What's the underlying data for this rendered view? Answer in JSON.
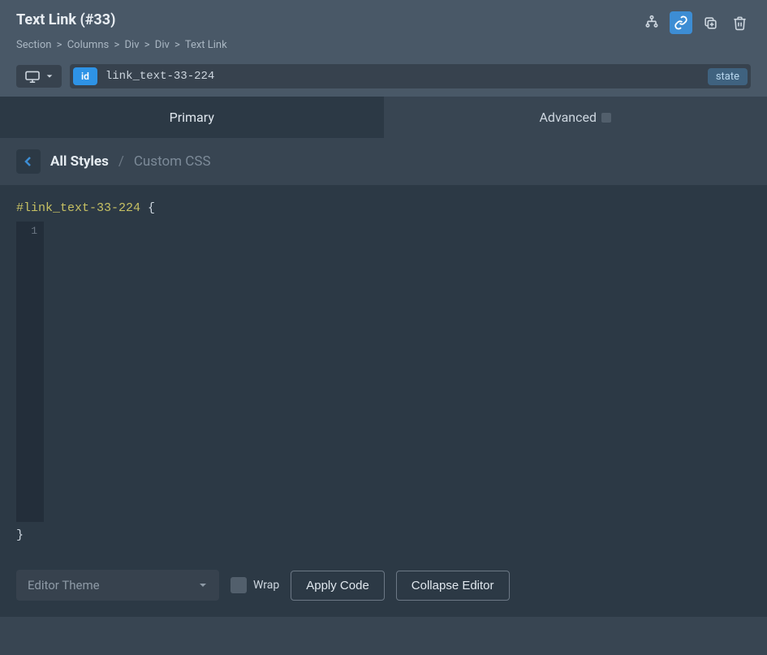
{
  "header": {
    "title": "Text Link (#33)",
    "breadcrumb": [
      "Section",
      "Columns",
      "Div",
      "Div",
      "Text Link"
    ]
  },
  "toolbar": {
    "id_badge": "id",
    "id_value": "link_text-33-224",
    "state_label": "state"
  },
  "tabs": {
    "primary": "Primary",
    "advanced": "Advanced"
  },
  "subheader": {
    "all_styles": "All Styles",
    "current": "Custom CSS"
  },
  "editor": {
    "selector": "#link_text-33-224",
    "open_brace": "{",
    "close_brace": "}",
    "line_number": "1"
  },
  "footer": {
    "theme_placeholder": "Editor Theme",
    "wrap_label": "Wrap",
    "apply_btn": "Apply Code",
    "collapse_btn": "Collapse Editor"
  }
}
